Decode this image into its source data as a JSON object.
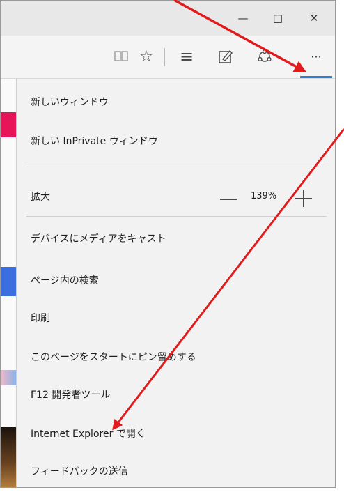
{
  "window": {
    "minimize_glyph": "—",
    "restore_glyph": "□",
    "close_glyph": "✕"
  },
  "toolbar": {
    "reading_view_icon": "book-icon",
    "favorites_glyph": "☆",
    "hub_glyph": "≡",
    "web_note_icon": "pen-square-icon",
    "share_icon": "share-icon",
    "more_glyph": "···"
  },
  "menu": {
    "items": [
      "新しいウィンドウ",
      "新しい InPrivate ウィンドウ",
      "拡大",
      "デバイスにメディアをキャスト",
      "ページ内の検索",
      "印刷",
      "このページをスタートにピン留めする",
      "F12 開発者ツール",
      "Internet Explorer で開く",
      "フィードバックの送信"
    ],
    "zoom_value": "139%"
  },
  "colors": {
    "annotation_arrow": "#e11b1b",
    "accent": "#2b7fd6",
    "menu_bg": "#f2f2f2"
  }
}
